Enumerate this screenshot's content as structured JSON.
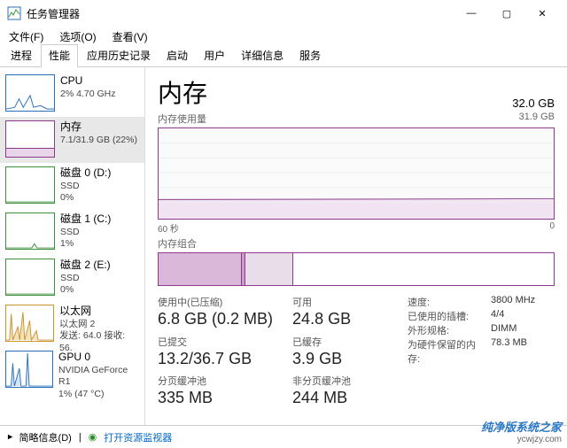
{
  "window": {
    "title": "任务管理器",
    "min": "—",
    "max": "▢",
    "close": "✕"
  },
  "menu": {
    "file": "文件(F)",
    "options": "选项(O)",
    "view": "查看(V)"
  },
  "tabs": [
    "进程",
    "性能",
    "应用历史记录",
    "启动",
    "用户",
    "详细信息",
    "服务"
  ],
  "active_tab": 1,
  "sidebar": [
    {
      "title": "CPU",
      "sub": "2%  4.70 GHz"
    },
    {
      "title": "内存",
      "sub": "7.1/31.9 GB (22%)"
    },
    {
      "title": "磁盘 0 (D:)",
      "sub": "SSD",
      "sub2": "0%"
    },
    {
      "title": "磁盘 1 (C:)",
      "sub": "SSD",
      "sub2": "1%"
    },
    {
      "title": "磁盘 2 (E:)",
      "sub": "SSD",
      "sub2": "0%"
    },
    {
      "title": "以太网",
      "sub": "以太网 2",
      "sub2": "发送: 64.0  接收: 56."
    },
    {
      "title": "GPU 0",
      "sub": "NVIDIA GeForce R1",
      "sub2": "1%  (47 °C)"
    }
  ],
  "header": {
    "title": "内存",
    "capacity": "32.0 GB"
  },
  "graph": {
    "label": "内存使用量",
    "max": "31.9 GB",
    "xl": "60 秒",
    "xr": "0"
  },
  "comp_label": "内存组合",
  "stats": {
    "used_lbl": "使用中(已压缩)",
    "used": "6.8 GB (0.2 MB)",
    "avail_lbl": "可用",
    "avail": "24.8 GB",
    "commit_lbl": "已提交",
    "commit": "13.2/36.7 GB",
    "cached_lbl": "已缓存",
    "cached": "3.9 GB",
    "paged_lbl": "分页缓冲池",
    "paged": "335 MB",
    "nonpaged_lbl": "非分页缓冲池",
    "nonpaged": "244 MB"
  },
  "props": {
    "speed_l": "速度:",
    "speed": "3800 MHz",
    "slots_l": "已使用的插槽:",
    "slots": "4/4",
    "form_l": "外形规格:",
    "form": "DIMM",
    "hw_l": "为硬件保留的内存:",
    "hw": "78.3 MB"
  },
  "footer": {
    "less": "简略信息(D)",
    "resmon": "打开资源监视器"
  },
  "watermark": {
    "brand": "纯净版系统之家",
    "url": "ycwjzy.com"
  },
  "chart_data": {
    "type": "line",
    "title": "内存使用量",
    "xlabel": "60 秒",
    "ylabel": "GB",
    "ylim": [
      0,
      31.9
    ],
    "x": [
      60,
      55,
      50,
      45,
      40,
      35,
      30,
      25,
      20,
      15,
      10,
      5,
      0
    ],
    "values": [
      6.8,
      6.8,
      6.8,
      6.8,
      6.8,
      6.8,
      6.8,
      6.8,
      6.9,
      6.9,
      6.9,
      6.9,
      6.8
    ],
    "composition": {
      "in_use_gb": 6.8,
      "modified_gb": 0.3,
      "standby_gb": 3.9,
      "free_gb": 20.9
    }
  }
}
